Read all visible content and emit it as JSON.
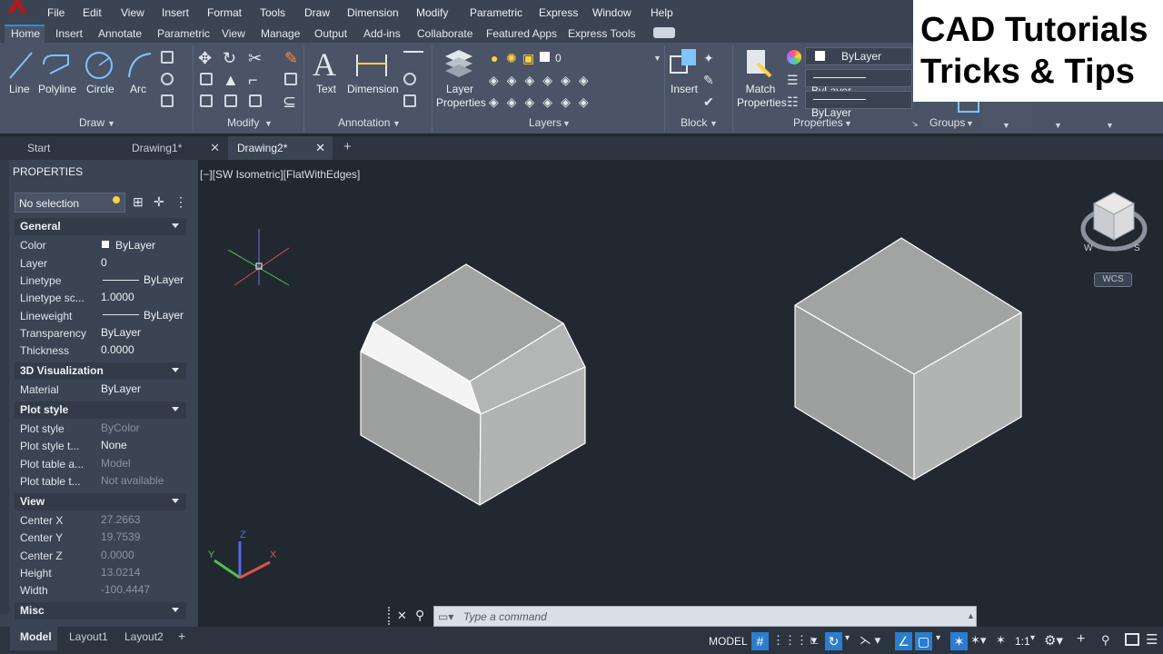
{
  "menubar": {
    "items": [
      "File",
      "Edit",
      "View",
      "Insert",
      "Format",
      "Tools",
      "Draw",
      "Dimension",
      "Modify",
      "Parametric",
      "Express",
      "Window",
      "Help"
    ]
  },
  "ribbon_tabs": [
    "Home",
    "Insert",
    "Annotate",
    "Parametric",
    "View",
    "Manage",
    "Output",
    "Add-ins",
    "Collaborate",
    "Featured Apps",
    "Express Tools"
  ],
  "ribbon": {
    "draw": {
      "title": "Draw",
      "line": "Line",
      "polyline": "Polyline",
      "circle": "Circle",
      "arc": "Arc"
    },
    "modify": {
      "title": "Modify"
    },
    "annotation": {
      "title": "Annotation",
      "text": "Text",
      "dimension": "Dimension"
    },
    "layers": {
      "title": "Layers",
      "layer_properties": "Layer Properties",
      "current_layer": "0"
    },
    "block": {
      "title": "Block",
      "insert": "Insert"
    },
    "properties": {
      "title": "Properties",
      "match": "Match Properties",
      "color": "ByLayer",
      "linetype": "ByLayer",
      "lineweight": "ByLayer"
    },
    "groups": {
      "title": "Groups"
    }
  },
  "doc_tabs": [
    "Start",
    "Drawing1*",
    "Drawing2*"
  ],
  "properties_palette": {
    "title": "PROPERTIES",
    "selection": "No selection",
    "sections": {
      "general": {
        "title": "General",
        "rows": [
          {
            "k": "Color",
            "v": "ByLayer"
          },
          {
            "k": "Layer",
            "v": "0"
          },
          {
            "k": "Linetype",
            "v": "ByLayer"
          },
          {
            "k": "Linetype sc...",
            "v": "1.0000"
          },
          {
            "k": "Lineweight",
            "v": "ByLayer"
          },
          {
            "k": "Transparency",
            "v": "ByLayer"
          },
          {
            "k": "Thickness",
            "v": "0.0000"
          }
        ]
      },
      "viz": {
        "title": "3D Visualization",
        "rows": [
          {
            "k": "Material",
            "v": "ByLayer"
          }
        ]
      },
      "plot": {
        "title": "Plot style",
        "rows": [
          {
            "k": "Plot style",
            "v": "ByColor"
          },
          {
            "k": "Plot style t...",
            "v": "None"
          },
          {
            "k": "Plot table a...",
            "v": "Model"
          },
          {
            "k": "Plot table t...",
            "v": "Not available"
          }
        ]
      },
      "view": {
        "title": "View",
        "rows": [
          {
            "k": "Center X",
            "v": "27.2663"
          },
          {
            "k": "Center Y",
            "v": "19.7539"
          },
          {
            "k": "Center Z",
            "v": "0.0000"
          },
          {
            "k": "Height",
            "v": "13.0214"
          },
          {
            "k": "Width",
            "v": "-100.4447"
          }
        ]
      },
      "misc": {
        "title": "Misc"
      }
    }
  },
  "viewport": {
    "label": "[−][SW Isometric][FlatWithEdges]",
    "wcs": "WCS"
  },
  "command": {
    "placeholder": "Type a command"
  },
  "layout_tabs": [
    "Model",
    "Layout1",
    "Layout2"
  ],
  "statusbar": {
    "model": "MODEL",
    "scale": "1:1"
  },
  "overlay": {
    "line1": "CAD Tutorials",
    "line2": "Tricks & Tips"
  }
}
